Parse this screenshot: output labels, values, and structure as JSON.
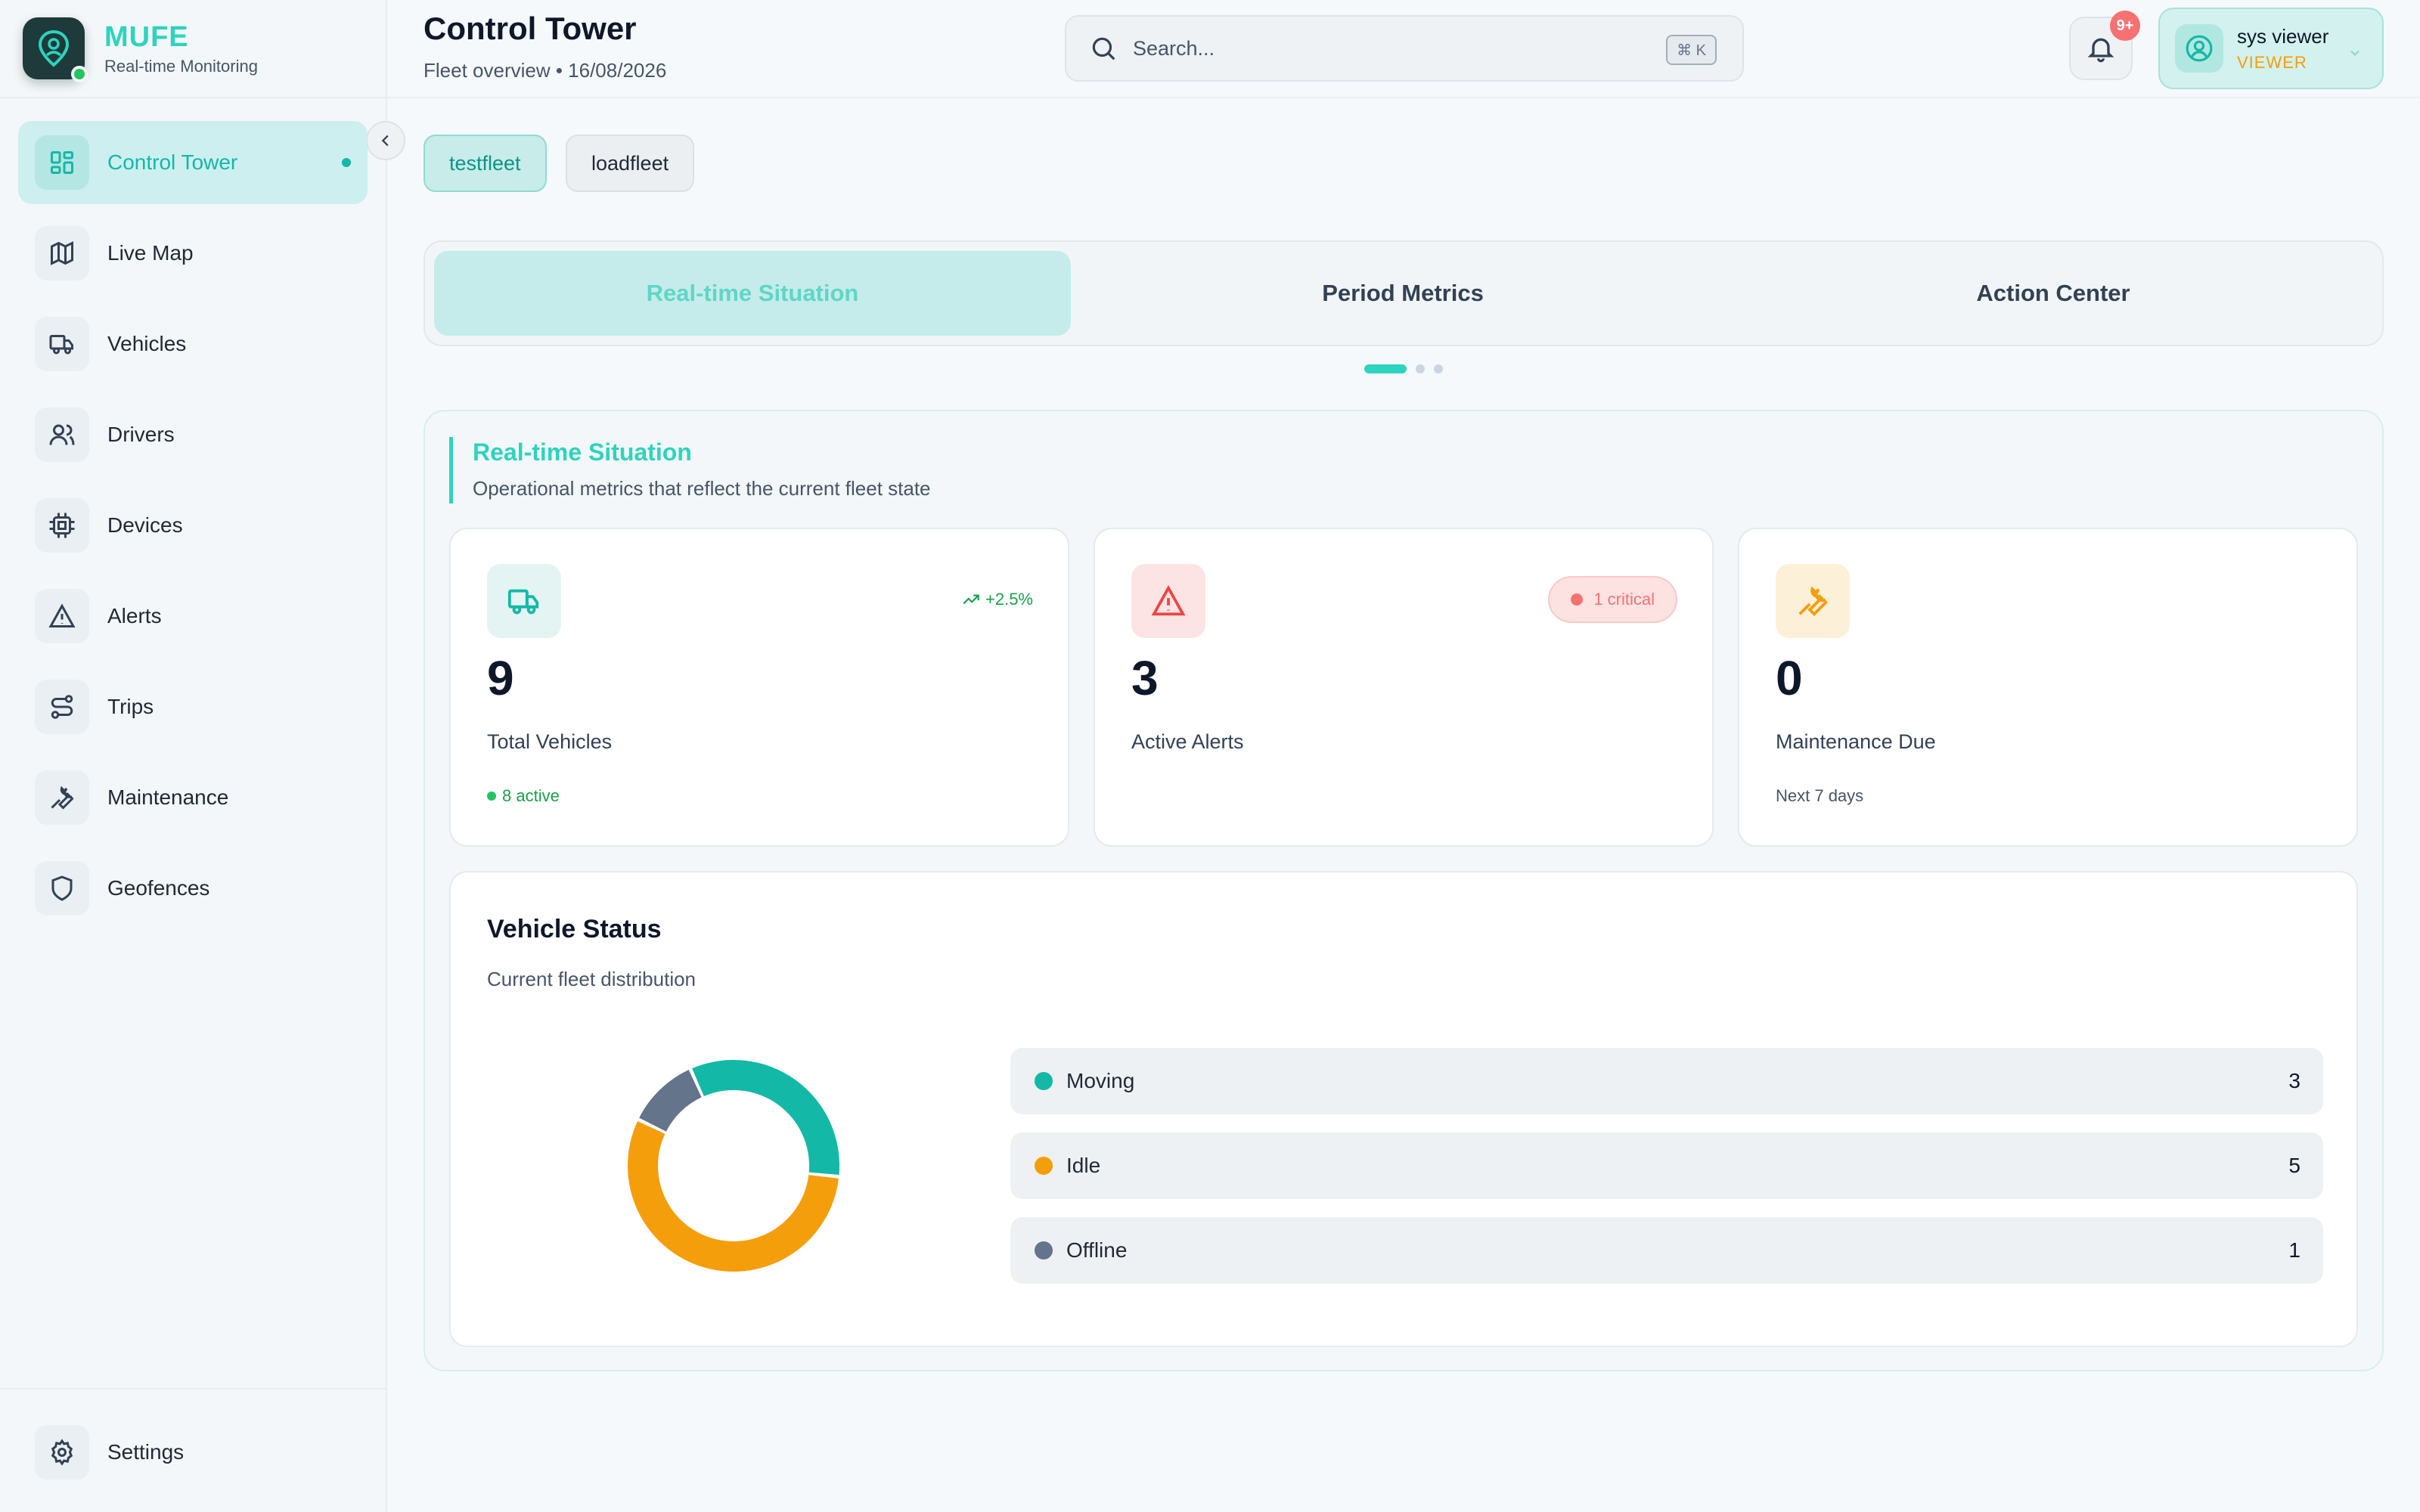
{
  "brand": {
    "name": "MUFE",
    "subtitle": "Real-time Monitoring"
  },
  "sidebar": {
    "items": [
      {
        "label": "Control Tower",
        "icon": "layout-grid-icon",
        "active": true
      },
      {
        "label": "Live Map",
        "icon": "map-icon"
      },
      {
        "label": "Vehicles",
        "icon": "truck-icon"
      },
      {
        "label": "Drivers",
        "icon": "users-icon"
      },
      {
        "label": "Devices",
        "icon": "cpu-icon"
      },
      {
        "label": "Alerts",
        "icon": "alert-triangle-icon"
      },
      {
        "label": "Trips",
        "icon": "route-icon"
      },
      {
        "label": "Maintenance",
        "icon": "wrench-icon"
      },
      {
        "label": "Geofences",
        "icon": "shield-icon"
      }
    ],
    "settings_label": "Settings"
  },
  "header": {
    "title": "Control Tower",
    "subtitle": "Fleet overview • 16/08/2026",
    "search_placeholder": "Search...",
    "search_shortcut": "⌘ K",
    "notification_badge": "9+",
    "user_name": "sys viewer",
    "user_role": "VIEWER"
  },
  "fleets": [
    {
      "label": "testfleet",
      "selected": true
    },
    {
      "label": "loadfleet",
      "selected": false
    }
  ],
  "tabs": [
    {
      "label": "Real-time Situation",
      "active": true
    },
    {
      "label": "Period Metrics"
    },
    {
      "label": "Action Center"
    }
  ],
  "section": {
    "title": "Real-time Situation",
    "subtitle": "Operational metrics that reflect the current fleet state"
  },
  "cards": {
    "vehicles": {
      "value": "9",
      "label": "Total Vehicles",
      "trend": "+2.5%",
      "footer": "8 active"
    },
    "alerts": {
      "value": "3",
      "label": "Active Alerts",
      "badge": "1 critical"
    },
    "maintenance": {
      "value": "0",
      "label": "Maintenance Due",
      "footer": "Next 7 days"
    }
  },
  "vehicle_status": {
    "title": "Vehicle Status",
    "subtitle": "Current fleet distribution",
    "items": [
      {
        "label": "Moving",
        "count": "3",
        "value": 3,
        "color": "#14b8a6"
      },
      {
        "label": "Idle",
        "count": "5",
        "value": 5,
        "color": "#f59e0b"
      },
      {
        "label": "Offline",
        "count": "1",
        "value": 1,
        "color": "#64748b"
      }
    ]
  },
  "colors": {
    "accent": "#2dd4bf",
    "accent_dark": "#14b8a6",
    "warning": "#f59e0b",
    "danger": "#f87171"
  }
}
